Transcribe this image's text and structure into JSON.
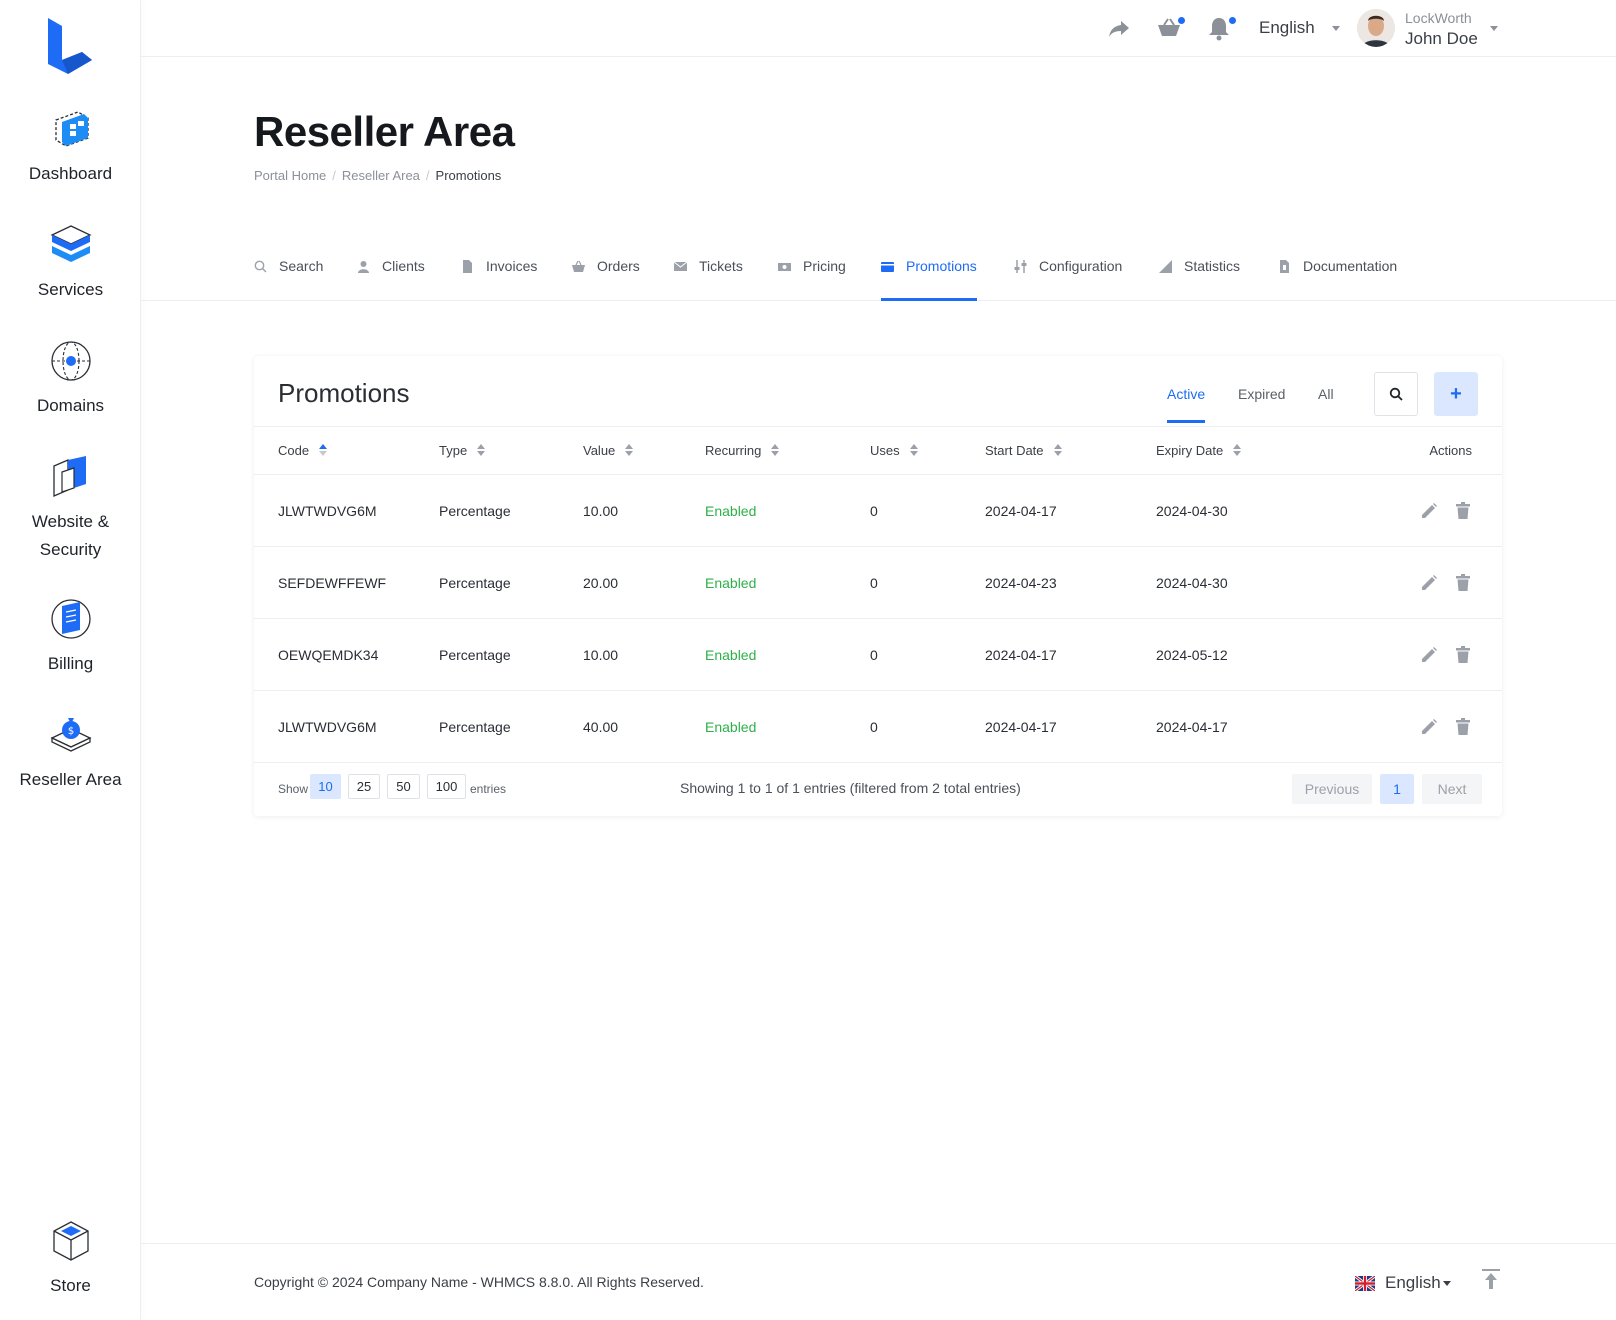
{
  "sidebar": {
    "items": [
      {
        "label": "Dashboard",
        "icon": "dashboard-icon"
      },
      {
        "label": "Services",
        "icon": "services-icon"
      },
      {
        "label": "Domains",
        "icon": "globe-icon"
      },
      {
        "label": "Website & Security",
        "icon": "security-icon"
      },
      {
        "label": "Billing",
        "icon": "billing-icon"
      },
      {
        "label": "Reseller Area",
        "icon": "reseller-icon"
      }
    ],
    "store": {
      "label": "Store",
      "icon": "store-icon"
    }
  },
  "header": {
    "language": "English",
    "user_company": "LockWorth",
    "user_name": "John Doe"
  },
  "page": {
    "title": "Reseller Area",
    "breadcrumb": [
      "Portal Home",
      "Reseller Area",
      "Promotions"
    ]
  },
  "tabs": [
    {
      "label": "Search",
      "icon": "search-icon"
    },
    {
      "label": "Clients",
      "icon": "user-icon"
    },
    {
      "label": "Invoices",
      "icon": "file-icon"
    },
    {
      "label": "Orders",
      "icon": "basket-icon"
    },
    {
      "label": "Tickets",
      "icon": "envelope-icon"
    },
    {
      "label": "Pricing",
      "icon": "money-icon"
    },
    {
      "label": "Promotions",
      "icon": "wallet-icon"
    },
    {
      "label": "Configuration",
      "icon": "sliders-icon"
    },
    {
      "label": "Statistics",
      "icon": "chart-icon"
    },
    {
      "label": "Documentation",
      "icon": "document-icon"
    }
  ],
  "card": {
    "title": "Promotions",
    "filters": [
      "Active",
      "Expired",
      "All"
    ],
    "add_label": "+"
  },
  "table": {
    "columns": [
      "Code",
      "Type",
      "Value",
      "Recurring",
      "Uses",
      "Start Date",
      "Expiry Date",
      "Actions"
    ],
    "rows": [
      {
        "code": "JLWTWDVG6M",
        "type": "Percentage",
        "value": "10.00",
        "recurring": "Enabled",
        "uses": "0",
        "start": "2024-04-17",
        "expiry": "2024-04-30"
      },
      {
        "code": "SEFDEWFFEWF",
        "type": "Percentage",
        "value": "20.00",
        "recurring": "Enabled",
        "uses": "0",
        "start": "2024-04-23",
        "expiry": "2024-04-30"
      },
      {
        "code": "OEWQEMDK34",
        "type": "Percentage",
        "value": "10.00",
        "recurring": "Enabled",
        "uses": "0",
        "start": "2024-04-17",
        "expiry": "2024-05-12"
      },
      {
        "code": "JLWTWDVG6M",
        "type": "Percentage",
        "value": "40.00",
        "recurring": "Enabled",
        "uses": "0",
        "start": "2024-04-17",
        "expiry": "2024-04-17"
      }
    ]
  },
  "pagination": {
    "show_label": "Show",
    "sizes": [
      "10",
      "25",
      "50",
      "100"
    ],
    "entries_label": "entries",
    "info": "Showing 1 to 1 of 1 entries (filtered from 2 total entries)",
    "previous": "Previous",
    "current_page": "1",
    "next": "Next"
  },
  "footer": {
    "copyright": "Copyright © 2024 Company Name - WHMCS 8.8.0. All Rights Reserved.",
    "language": "English"
  },
  "colors": {
    "accent": "#1e6cf5",
    "success": "#2db04a"
  }
}
